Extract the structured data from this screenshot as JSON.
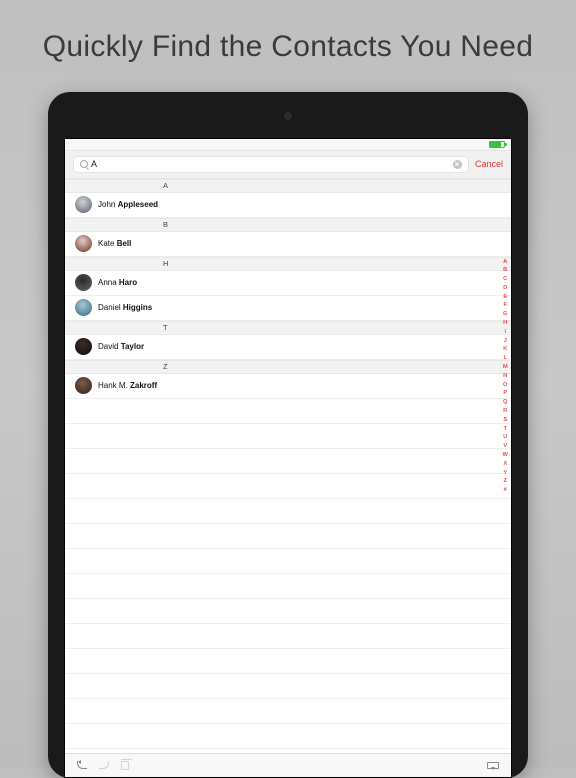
{
  "headline": "Quickly Find the Contacts You Need",
  "search": {
    "value": "A",
    "cancel": "Cancel"
  },
  "sections": [
    {
      "letter": "A",
      "contacts": [
        {
          "first": "John",
          "last": "Appleseed",
          "avatar": "#cfd3d8,#70767f"
        }
      ]
    },
    {
      "letter": "B",
      "contacts": [
        {
          "first": "Kate",
          "last": "Bell",
          "avatar": "#e7cec6,#7a5046"
        }
      ]
    },
    {
      "letter": "H",
      "contacts": [
        {
          "first": "Anna",
          "last": "Haro",
          "avatar": "#2a2a2a,#5a5a5a"
        },
        {
          "first": "Daniel",
          "last": "Higgins",
          "avatar": "#a7c8d6,#4a7c8e"
        }
      ]
    },
    {
      "letter": "T",
      "contacts": [
        {
          "first": "David",
          "last": "Taylor",
          "avatar": "#3a2e28,#1a1310"
        }
      ]
    },
    {
      "letter": "Z",
      "contacts": [
        {
          "first": "Hank M.",
          "last": "Zakroff",
          "avatar": "#7a5a4a,#3e2c22"
        }
      ]
    }
  ],
  "index_strip": [
    "A",
    "B",
    "C",
    "D",
    "E",
    "F",
    "G",
    "H",
    "I",
    "J",
    "K",
    "L",
    "M",
    "N",
    "O",
    "P",
    "Q",
    "R",
    "S",
    "T",
    "U",
    "V",
    "W",
    "X",
    "Y",
    "Z",
    "#"
  ]
}
